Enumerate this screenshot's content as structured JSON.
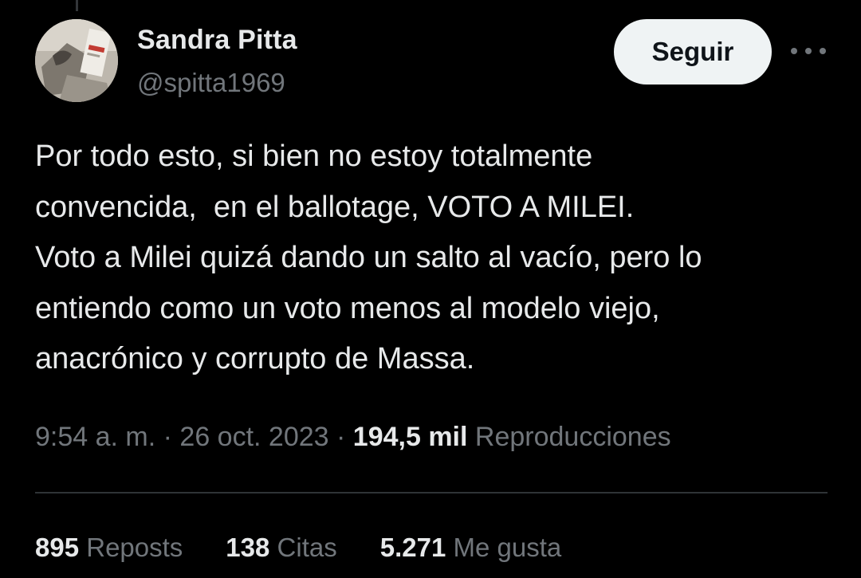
{
  "author": {
    "display_name": "Sandra Pitta",
    "handle": "@spitta1969"
  },
  "follow_label": "Seguir",
  "tweet": {
    "text": "Por todo esto, si bien no estoy totalmente\nconvencida,  en el ballotage, VOTO A MILEI.\nVoto a Milei quizá dando un salto al vacío, pero lo\nentiendo como un voto menos al modelo viejo,\nanacrónico y corrupto de Massa."
  },
  "meta": {
    "time": "9:54 a. m.",
    "separator": " · ",
    "date": "26 oct. 2023",
    "views_count": "194,5 mil",
    "views_label": "Reproducciones"
  },
  "stats": {
    "reposts": {
      "count": "895",
      "label": "Reposts"
    },
    "quotes": {
      "count": "138",
      "label": "Citas"
    },
    "likes": {
      "count": "5.271",
      "label": "Me gusta"
    }
  },
  "icons": {
    "more": "more-horizontal-icon"
  },
  "colors": {
    "background": "#000000",
    "primary_text": "#e7e9ea",
    "secondary_text": "#71767b",
    "button_bg": "#eff3f4",
    "divider": "#2f3336"
  }
}
